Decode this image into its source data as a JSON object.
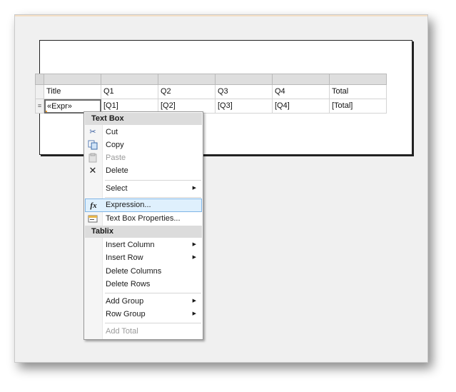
{
  "tablix": {
    "headers": [
      "Title",
      "Q1",
      "Q2",
      "Q3",
      "Q4",
      "Total"
    ],
    "row_handle_glyph": "≡",
    "data_row": [
      "«Expr»",
      "[Q1]",
      "[Q2]",
      "[Q3]",
      "[Q4]",
      "[Total]"
    ]
  },
  "context_menu": {
    "textbox_header": "Text Box",
    "cut": "Cut",
    "copy": "Copy",
    "paste": "Paste",
    "delete": "Delete",
    "select": "Select",
    "expression": "Expression...",
    "textbox_properties": "Text Box Properties...",
    "tablix_header": "Tablix",
    "insert_column": "Insert Column",
    "insert_row": "Insert Row",
    "delete_columns": "Delete Columns",
    "delete_rows": "Delete Rows",
    "add_group": "Add Group",
    "row_group": "Row Group",
    "add_total": "Add Total",
    "submenu_arrow": "▶",
    "icon_cut": "✂",
    "icon_delete": "✕",
    "icon_expression": "fx"
  },
  "icons": {
    "cut": "scissors-icon",
    "copy": "copy-icon",
    "paste": "paste-icon",
    "delete": "delete-x-icon",
    "expression": "function-fx-icon",
    "properties": "properties-icon"
  },
  "colors": {
    "menu_highlight": "#dff0fd",
    "menu_highlight_border": "#7fb5e6",
    "section_header": "#dcdcdc",
    "selection_grip": "#f0a030"
  }
}
